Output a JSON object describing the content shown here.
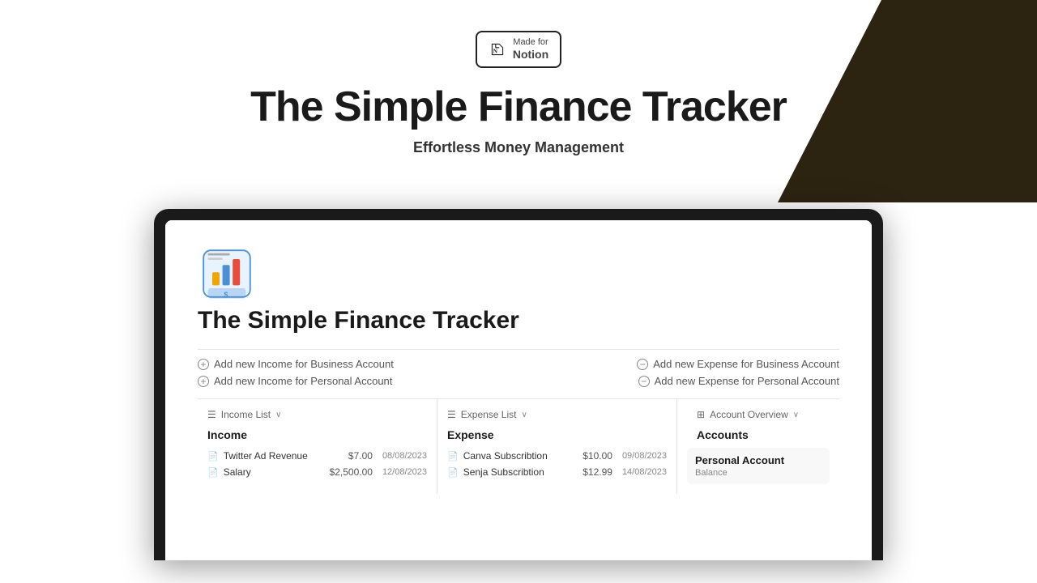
{
  "background": {
    "dark_color": "#2c2410",
    "light_color": "#ffffff"
  },
  "badge": {
    "made_for": "Made for",
    "notion": "Notion",
    "border_color": "#222222"
  },
  "header": {
    "title": "The Simple Finance Tracker",
    "subtitle": "Effortless Money Management"
  },
  "notion_page": {
    "page_title": "The Simple Finance Tracker",
    "actions": {
      "income_business": "Add new Income for Business Account",
      "income_personal": "Add new Income for Personal Account",
      "expense_business": "Add new Expense for Business Account",
      "expense_personal": "Add new Expense for Personal Account"
    },
    "income_section": {
      "header": "Income List",
      "col_title": "Income",
      "rows": [
        {
          "name": "Twitter Ad Revenue",
          "amount": "$7.00",
          "date": "08/08/2023"
        },
        {
          "name": "Salary",
          "amount": "$2,500.00",
          "date": "12/08/2023"
        }
      ]
    },
    "expense_section": {
      "header": "Expense List",
      "col_title": "Expense",
      "rows": [
        {
          "name": "Canva Subscribtion",
          "amount": "$10.00",
          "date": "09/08/2023"
        },
        {
          "name": "Senja Subscribtion",
          "amount": "$12.99",
          "date": "14/08/2023"
        }
      ]
    },
    "accounts_section": {
      "header": "Account Overview",
      "col_title": "Accounts",
      "account_name": "Personal Account",
      "balance_label": "Balance"
    }
  }
}
